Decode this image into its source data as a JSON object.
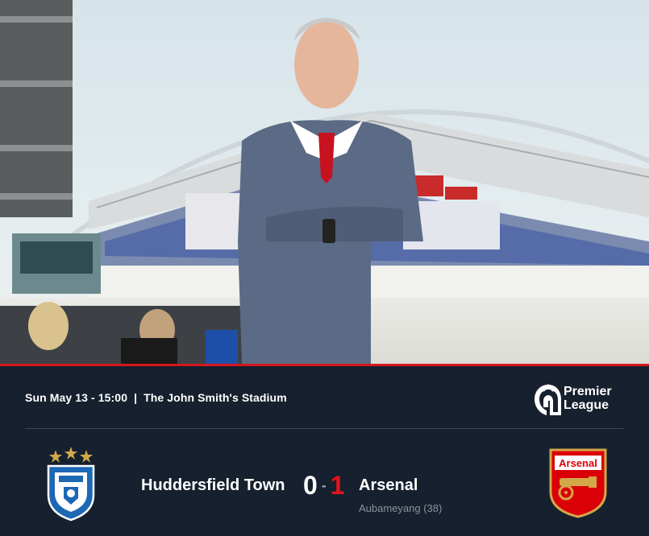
{
  "fixture": {
    "date_time": "Sun May 13 - 15:00",
    "separator": "|",
    "venue": "The John Smith's Stadium"
  },
  "competition": {
    "line1": "Premier",
    "line2": "League",
    "icon": "premier-league-lion-icon"
  },
  "match": {
    "home_team": "Huddersfield Town",
    "away_team": "Arsenal",
    "home_score": "0",
    "score_separator": "-",
    "away_score": "1",
    "away_scorers": "Aubameyang (38)"
  },
  "crests": {
    "away_label": "Arsenal"
  },
  "colors": {
    "panel_bg": "#16202e",
    "accent_red": "#d8151d",
    "away_red": "#e3141b",
    "muted_text": "#8a929c",
    "huddersfield_blue": "#1d68b5"
  }
}
